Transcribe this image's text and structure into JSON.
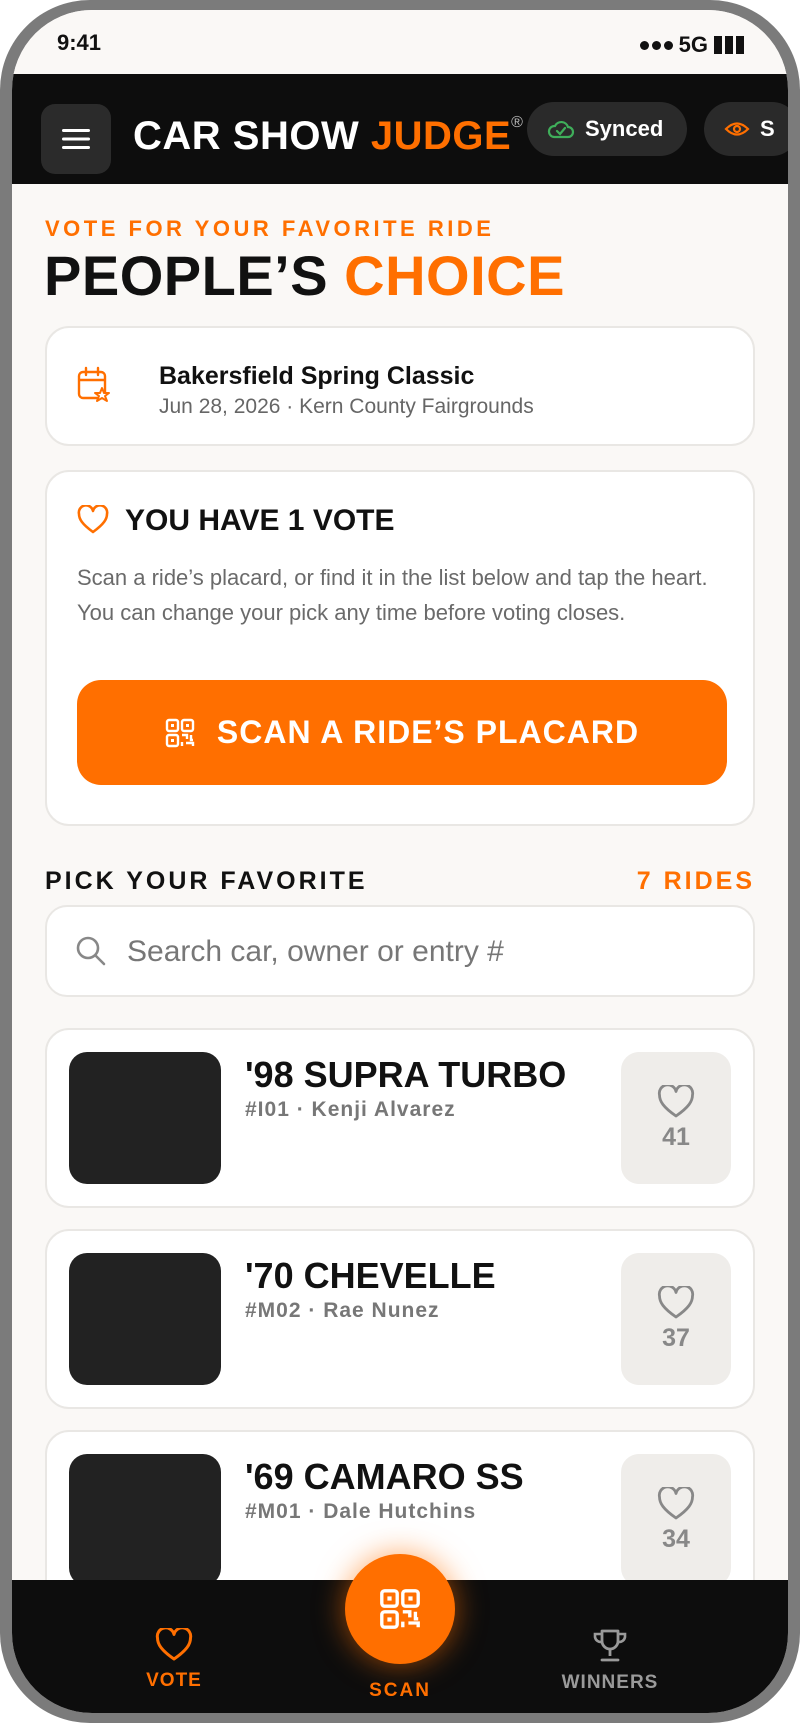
{
  "status_bar": {
    "time": "9:41",
    "network": "5G"
  },
  "header": {
    "brand_part1": "CAR SHOW ",
    "brand_part2": "JUDGE",
    "brand_mark": "®",
    "sync_status": "Synced",
    "second_pill_label": "S"
  },
  "hero": {
    "kicker": "VOTE FOR YOUR FAVORITE RIDE",
    "title_part1": "PEOPLE’S ",
    "title_part2": "CHOICE"
  },
  "event": {
    "name": "Bakersfield Spring Classic",
    "details": "Jun 28, 2026 · Kern County Fairgrounds"
  },
  "vote_card": {
    "title": "YOU HAVE 1 VOTE",
    "body": "Scan a ride’s placard, or find it in the list below and tap the heart. You can change your pick any time before voting closes.",
    "scan_button": "SCAN A RIDE’S PLACARD"
  },
  "list": {
    "section_label": "PICK YOUR FAVORITE",
    "count_label": "7 RIDES",
    "search_placeholder": "Search car, owner or entry #",
    "rides": [
      {
        "name": "'98 SUPRA TURBO",
        "entry": "#I01 · Kenji Alvarez",
        "votes": "41"
      },
      {
        "name": "'70 CHEVELLE",
        "entry": "#M02 · Rae Nunez",
        "votes": "37"
      },
      {
        "name": "'69 CAMARO SS",
        "entry": "#M01 · Dale Hutchins",
        "votes": "34"
      }
    ]
  },
  "nav": {
    "vote": "VOTE",
    "scan": "SCAN",
    "winners": "WINNERS"
  },
  "colors": {
    "accent": "#ff6f00",
    "header_bg": "#0d0d0d",
    "sync_icon": "#3fae5a"
  },
  "icons": [
    "menu-icon",
    "cloud-check-icon",
    "eye-icon",
    "calendar-star-icon",
    "heart-icon",
    "qr-code-icon",
    "search-icon",
    "trophy-icon"
  ]
}
